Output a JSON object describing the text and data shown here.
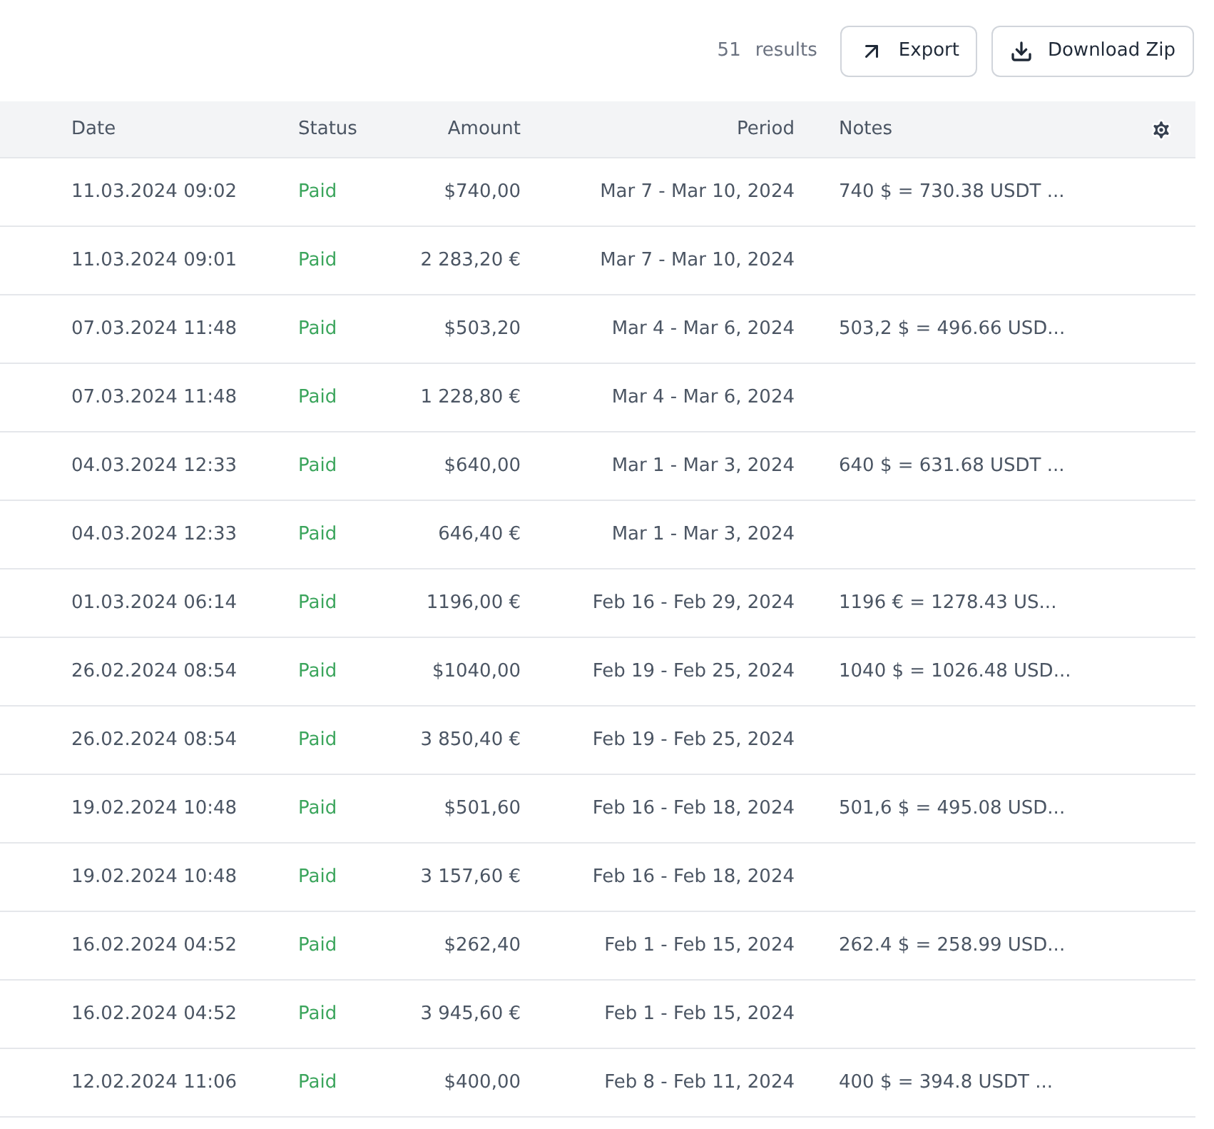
{
  "toolbar": {
    "results_count": "51",
    "results_label": "results",
    "buttons": [
      {
        "kind": "export",
        "label": "Export"
      },
      {
        "kind": "download",
        "label": "Download Zip"
      }
    ]
  },
  "table": {
    "columns": [
      "Date",
      "Status",
      "Amount",
      "Period",
      "Notes"
    ],
    "rows": [
      {
        "date": "11.03.2024 09:02",
        "status": {
          "label": "Paid",
          "kind": "paid"
        },
        "amount": "$740,00",
        "period": "Mar 7 - Mar 10, 2024",
        "notes": "740 $ = 730.38 USDT ..."
      },
      {
        "date": "11.03.2024 09:01",
        "status": {
          "label": "Paid",
          "kind": "paid"
        },
        "amount": "2 283,20 €",
        "period": "Mar 7 - Mar 10, 2024"
      },
      {
        "date": "07.03.2024 11:48",
        "status": {
          "label": "Paid",
          "kind": "paid"
        },
        "amount": "$503,20",
        "period": "Mar 4 - Mar 6, 2024",
        "notes": "503,2 $ = 496.66 USD..."
      },
      {
        "date": "07.03.2024 11:48",
        "status": {
          "label": "Paid",
          "kind": "paid"
        },
        "amount": "1 228,80 €",
        "period": "Mar 4 - Mar 6, 2024"
      },
      {
        "date": "04.03.2024 12:33",
        "status": {
          "label": "Paid",
          "kind": "paid"
        },
        "amount": "$640,00",
        "period": "Mar 1 - Mar 3, 2024",
        "notes": "640 $ = 631.68 USDT ..."
      },
      {
        "date": "04.03.2024 12:33",
        "status": {
          "label": "Paid",
          "kind": "paid"
        },
        "amount": "646,40 €",
        "period": "Mar 1 - Mar 3, 2024"
      },
      {
        "date": "01.03.2024 06:14",
        "status": {
          "label": "Paid",
          "kind": "paid"
        },
        "amount": "1196,00 €",
        "period": "Feb 16 - Feb 29, 2024",
        "notes": "1196 € = 1278.43 US..."
      },
      {
        "date": "26.02.2024 08:54",
        "status": {
          "label": "Paid",
          "kind": "paid"
        },
        "amount": "$1040,00",
        "period": "Feb 19 - Feb 25, 2024",
        "notes": "1040 $ = 1026.48 USD..."
      },
      {
        "date": "26.02.2024 08:54",
        "status": {
          "label": "Paid",
          "kind": "paid"
        },
        "amount": "3 850,40 €",
        "period": "Feb 19 - Feb 25, 2024"
      },
      {
        "date": "19.02.2024 10:48",
        "status": {
          "label": "Paid",
          "kind": "paid"
        },
        "amount": "$501,60",
        "period": "Feb 16 - Feb 18, 2024",
        "notes": "501,6 $ = 495.08 USD..."
      },
      {
        "date": "19.02.2024 10:48",
        "status": {
          "label": "Paid",
          "kind": "paid"
        },
        "amount": "3 157,60 €",
        "period": "Feb 16 - Feb 18, 2024"
      },
      {
        "date": "16.02.2024 04:52",
        "status": {
          "label": "Paid",
          "kind": "paid"
        },
        "amount": "$262,40",
        "period": "Feb 1 - Feb 15, 2024",
        "notes": "262.4 $ = 258.99 USD..."
      },
      {
        "date": "16.02.2024 04:52",
        "status": {
          "label": "Paid",
          "kind": "paid"
        },
        "amount": "3 945,60 €",
        "period": "Feb 1 - Feb 15, 2024"
      },
      {
        "date": "12.02.2024 11:06",
        "status": {
          "label": "Paid",
          "kind": "paid"
        },
        "amount": "$400,00",
        "period": "Feb 8 - Feb 11, 2024",
        "notes": "400 $ = 394.8 USDT ..."
      }
    ]
  }
}
